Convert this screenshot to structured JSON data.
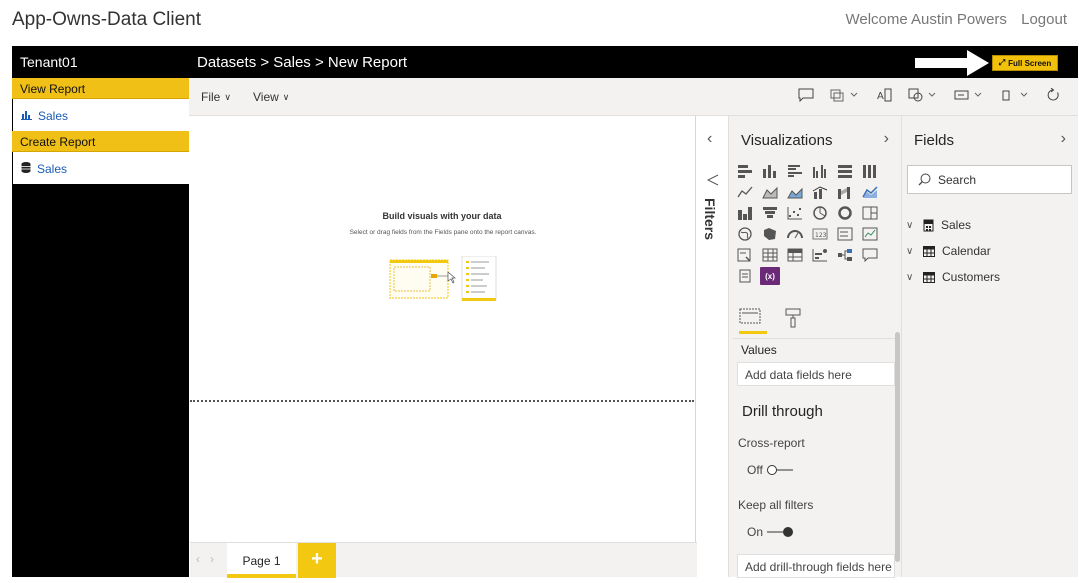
{
  "app": {
    "title": "App-Owns-Data Client",
    "welcome": "Welcome Austin Powers",
    "logout": "Logout"
  },
  "sidebar": {
    "tenant": "Tenant01",
    "sections": [
      {
        "header": "View Report",
        "item": "Sales",
        "icon": "bar-chart-icon"
      },
      {
        "header": "Create Report",
        "item": "Sales",
        "icon": "database-icon"
      }
    ]
  },
  "report_header": {
    "breadcrumb": "Datasets > Sales > New Report",
    "fullscreen_label": "Full Screen"
  },
  "toolbar": {
    "file_label": "File",
    "view_label": "View"
  },
  "canvas": {
    "empty_title": "Build visuals with your data",
    "empty_subtitle": "Select or drag fields from the Fields pane onto the report canvas."
  },
  "pages": {
    "tabs": [
      {
        "label": "Page 1"
      }
    ],
    "add_label": "+"
  },
  "filters": {
    "label": "Filters"
  },
  "visualizations": {
    "title": "Visualizations",
    "values_label": "Values",
    "values_placeholder": "Add data fields here",
    "drill_title": "Drill through",
    "cross_report_label": "Cross-report",
    "cross_report_state": "Off",
    "keep_filters_label": "Keep all filters",
    "keep_filters_state": "On",
    "drill_placeholder": "Add drill-through fields here"
  },
  "fields": {
    "title": "Fields",
    "search_placeholder": "Search",
    "tables": [
      {
        "name": "Sales",
        "icon": "calculator-icon"
      },
      {
        "name": "Calendar",
        "icon": "table-icon"
      },
      {
        "name": "Customers",
        "icon": "table-icon"
      }
    ]
  },
  "colors": {
    "accent": "#f2c811",
    "sidebar_header": "#f0c016",
    "link": "#1a5bb4",
    "custom_visual": "#6b2a78"
  }
}
